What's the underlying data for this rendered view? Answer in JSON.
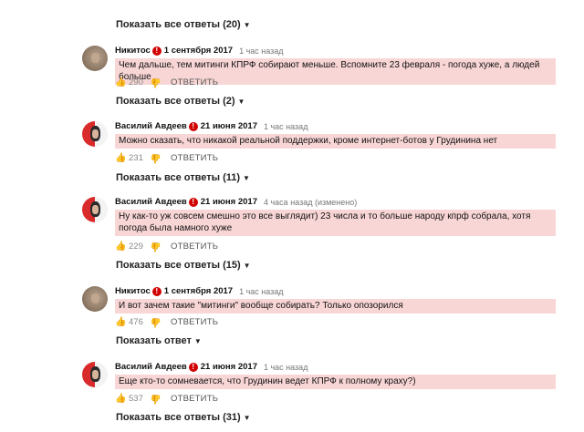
{
  "top_show_all": "Показать все ответы (20)",
  "comments": [
    {
      "author": "Никитос",
      "date": "1 сентября 2017",
      "ago": "1 час назад",
      "text": "Чем дальше, тем митинги КПРФ собирают меньше. Вспомните 23 февраля - погода хуже, а людей больше",
      "likes": "290",
      "reply": "ОТВЕТИТЬ",
      "show_all": "Показать все ответы (2)",
      "avatar": "nikitos"
    },
    {
      "author": "Василий Авдеев",
      "date": "21 июня 2017",
      "ago": "1 час назад",
      "text": "Можно сказать, что никакой реальной поддержки, кроме интернет-ботов у Грудинина нет",
      "likes": "231",
      "reply": "ОТВЕТИТЬ",
      "show_all": "Показать все ответы (11)",
      "avatar": "vasily"
    },
    {
      "author": "Василий Авдеев",
      "date": "21 июня 2017",
      "ago": "4 часа назад (изменено)",
      "text": "Ну как-то уж совсем смешно это все выглядит) 23 числа и то больше народу кпрф собрала, хотя погода была намного хуже",
      "likes": "229",
      "reply": "ОТВЕТИТЬ",
      "show_all": "Показать все ответы (15)",
      "avatar": "vasily"
    },
    {
      "author": "Никитос",
      "date": "1 сентября 2017",
      "ago": "1 час назад",
      "text": "И вот зачем такие \"митинги\" вообще собирать? Только опозорился",
      "likes": "476",
      "reply": "ОТВЕТИТЬ",
      "show_all": "Показать ответ",
      "avatar": "nikitos"
    },
    {
      "author": "Василий Авдеев",
      "date": "21 июня 2017",
      "ago": "1 час назад",
      "text": "Еще кто-то сомневается, что Грудинин ведет КПРФ к полному краху?)",
      "likes": "537",
      "reply": "ОТВЕТИТЬ",
      "show_all": "Показать все ответы (31)",
      "avatar": "vasily"
    }
  ],
  "icons": {
    "like": "thumb-up-icon",
    "dislike": "thumb-down-icon",
    "flag": "exclamation-badge-icon",
    "expand": "chevron-down-icon"
  },
  "colors": {
    "highlight": "#f9d6d6",
    "flag": "#d10000"
  }
}
